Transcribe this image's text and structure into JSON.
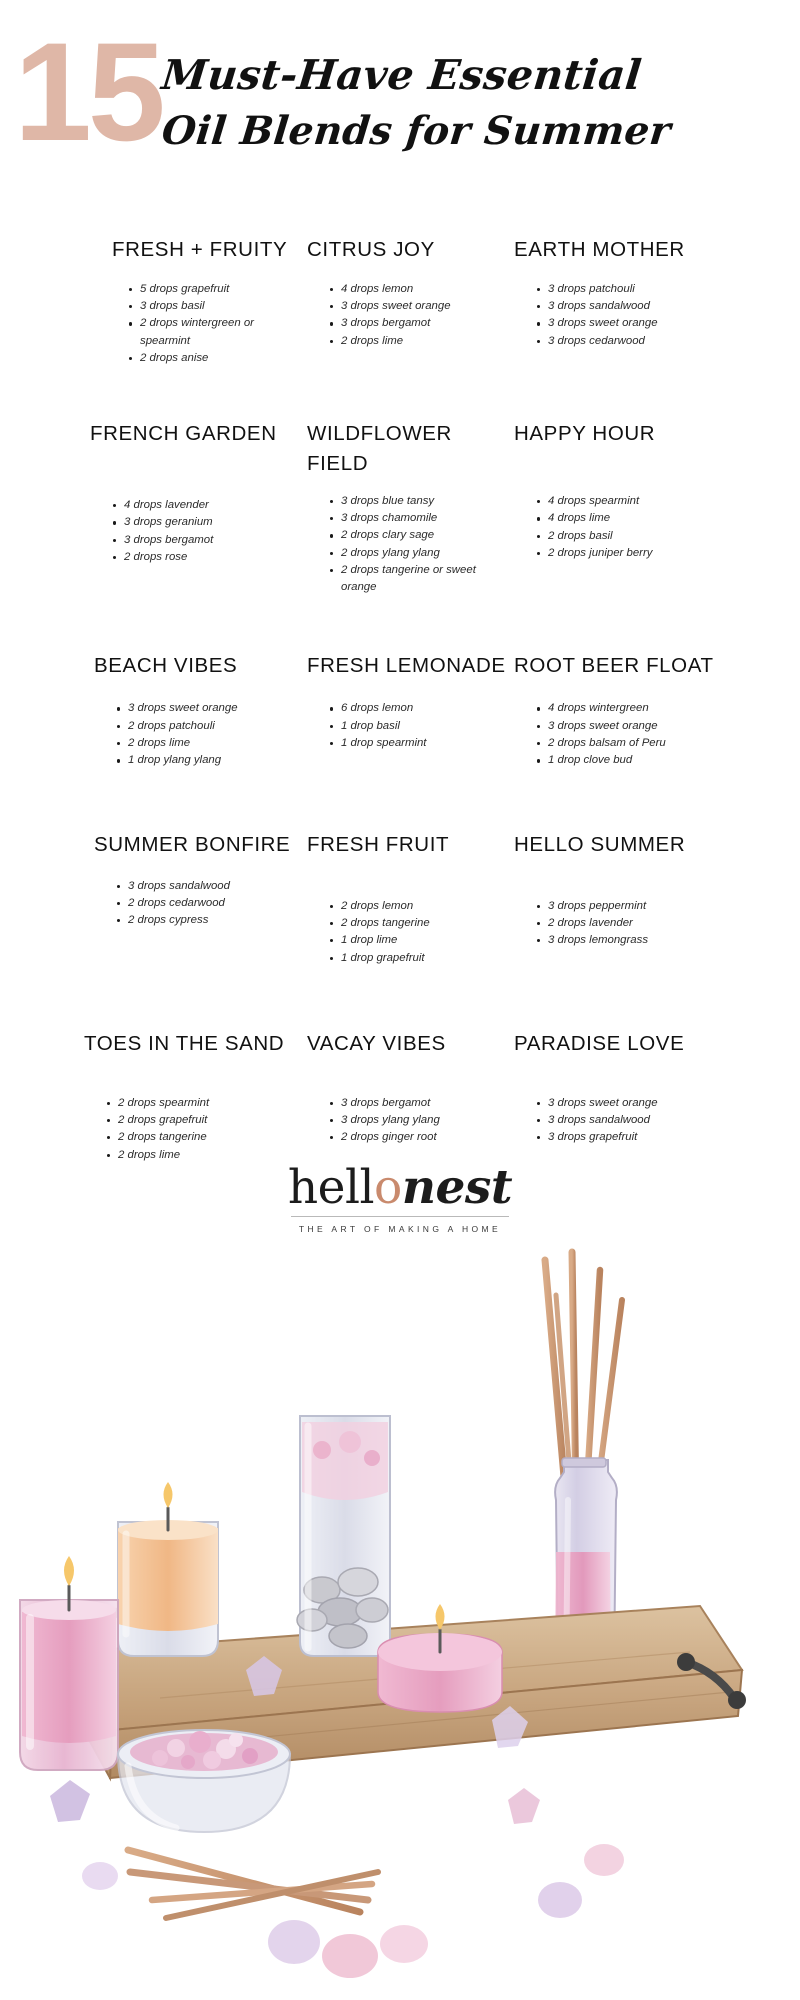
{
  "header": {
    "number": "15",
    "title_line1": "Must-Have Essential",
    "title_line2": "Oil Blends for Summer",
    "accent_color": "#dfb7a7"
  },
  "blends": [
    {
      "title": "FRESH + FRUITY",
      "items": [
        "5 drops grapefruit",
        "3 drops basil",
        "2 drops wintergreen or spearmint",
        "2 drops anise"
      ]
    },
    {
      "title": "CITRUS JOY",
      "items": [
        "4 drops lemon",
        "3 drops sweet orange",
        "3 drops bergamot",
        "2 drops lime"
      ]
    },
    {
      "title": "EARTH MOTHER",
      "items": [
        "3 drops patchouli",
        "3 drops sandalwood",
        "3 drops sweet orange",
        "3 drops cedarwood"
      ]
    },
    {
      "title": "FRENCH GARDEN",
      "items": [
        "4 drops lavender",
        "3 drops geranium",
        "3 drops bergamot",
        "2 drops rose"
      ]
    },
    {
      "title": "WILDFLOWER FIELD",
      "items": [
        "3 drops blue tansy",
        "3 drops chamomile",
        "2 drops clary sage",
        "2 drops ylang ylang",
        "2 drops tangerine or sweet orange"
      ]
    },
    {
      "title": "HAPPY HOUR",
      "items": [
        "4 drops spearmint",
        "4 drops lime",
        "2 drops basil",
        "2 drops juniper berry"
      ]
    },
    {
      "title": "BEACH VIBES",
      "items": [
        "3 drops sweet orange",
        "2 drops patchouli",
        "2 drops lime",
        "1 drop ylang ylang"
      ]
    },
    {
      "title": "FRESH LEMONADE",
      "items": [
        "6 drops lemon",
        "1 drop basil",
        "1 drop spearmint"
      ]
    },
    {
      "title": "ROOT BEER FLOAT",
      "items": [
        "4 drops wintergreen",
        "3 drops sweet orange",
        "2 drops balsam of Peru",
        "1 drop clove bud"
      ]
    },
    {
      "title": "SUMMER BONFIRE",
      "items": [
        "3 drops sandalwood",
        "2 drops cedarwood",
        "2 drops cypress"
      ]
    },
    {
      "title": "FRESH FRUIT",
      "items": [
        "2 drops lemon",
        "2 drops tangerine",
        "1 drop lime",
        "1 drop grapefruit"
      ]
    },
    {
      "title": "HELLO SUMMER",
      "items": [
        "3 drops peppermint",
        "2 drops lavender",
        "3 drops lemongrass"
      ]
    },
    {
      "title": "TOES IN THE SAND",
      "items": [
        "2 drops spearmint",
        "2 drops grapefruit",
        "2 drops tangerine",
        "2 drops lime"
      ]
    },
    {
      "title": "VACAY VIBES",
      "items": [
        "3 drops bergamot",
        "3 drops ylang ylang",
        "2 drops ginger root"
      ]
    },
    {
      "title": "PARADISE LOVE",
      "items": [
        "3 drops sweet orange",
        "3 drops sandalwood",
        "3 drops grapefruit"
      ]
    }
  ],
  "logo": {
    "word1": "hell",
    "accent_letter": "o",
    "word2": "nest",
    "tagline": "THE ART OF MAKING A HOME",
    "accent_color": "#c98a6d"
  },
  "illustration": {
    "name": "spa-still-life",
    "elements": [
      "wooden-tray",
      "pink-candle-glass",
      "orange-candle-glass",
      "pebble-glass",
      "reed-diffuser-bottle",
      "pink-tea-light",
      "bath-salt-bowl",
      "reed-sticks",
      "crystal-stones"
    ],
    "colors": {
      "tray_wood": "#c9a882",
      "pink_wax": "#e8a9c4",
      "peach_wax": "#f2c09a",
      "glass": "#dcdce8",
      "reed_stick": "#c89878",
      "crystal_purple": "#cdbbe0",
      "crystal_pink": "#f0c2d4"
    }
  }
}
